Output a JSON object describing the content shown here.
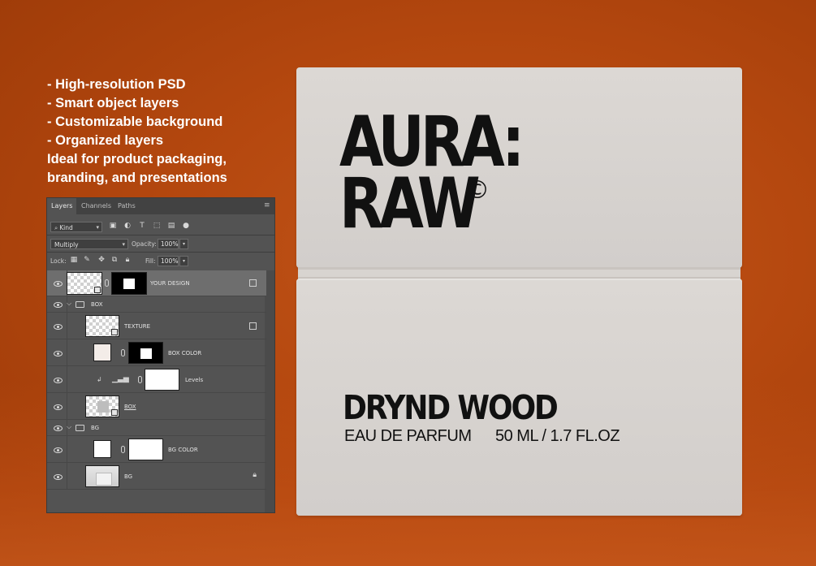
{
  "features": [
    "- High-resolution PSD",
    "- Smart object layers",
    "- Customizable background",
    "- Organized layers",
    "Ideal for product packaging,",
    "branding, and presentations"
  ],
  "panel": {
    "tabs": [
      "Layers",
      "Channels",
      "Paths"
    ],
    "filter_kind": "Kind",
    "blend_mode": "Multiply",
    "opacity_label": "Opacity:",
    "opacity_value": "100%",
    "lock_label": "Lock:",
    "fill_label": "Fill:",
    "fill_value": "100%",
    "layers": [
      {
        "name": "YOUR DESIGN",
        "type": "smart-object",
        "selected": true
      },
      {
        "name": "BOX",
        "type": "group"
      },
      {
        "name": "TEXTURE",
        "type": "smart-object"
      },
      {
        "name": "BOX COLOR",
        "type": "fill"
      },
      {
        "name": "Levels",
        "type": "adjustment"
      },
      {
        "name": "BOX",
        "type": "smart-object"
      },
      {
        "name": "BG",
        "type": "group"
      },
      {
        "name": "BG COLOR",
        "type": "fill"
      },
      {
        "name": "BG",
        "type": "image",
        "locked": true
      }
    ]
  },
  "product": {
    "brand_line1": "AURA:",
    "brand_line2": "RAW",
    "copyright_symbol": "©",
    "name": "DRYND WOOD",
    "subtitle": "EAU DE PARFUM",
    "volume": "50 ML / 1.7 FL.OZ"
  },
  "colors": {
    "background": "#b5480f",
    "box": "#d7d3cf",
    "panel": "#535353"
  }
}
